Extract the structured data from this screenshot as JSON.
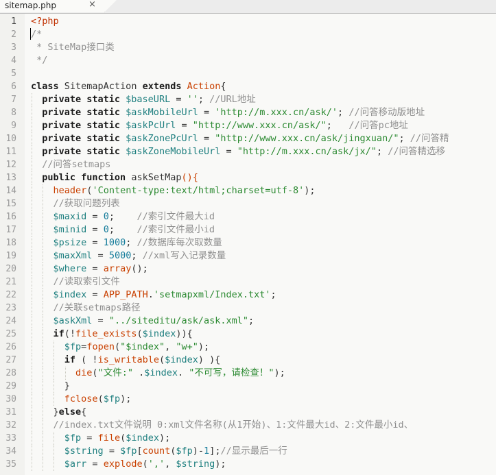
{
  "tab": {
    "filename": "sitemap.php",
    "close": "×"
  },
  "lines": [
    [
      {
        "t": "<?php",
        "c": "php"
      }
    ],
    [
      {
        "t": "/*",
        "c": "cm"
      }
    ],
    [
      {
        "t": " * SiteMap接口类",
        "c": "cm"
      }
    ],
    [
      {
        "t": " */",
        "c": "cm"
      }
    ],
    [],
    [
      {
        "t": "class ",
        "c": "kw"
      },
      {
        "t": "SitemapAction ",
        "c": ""
      },
      {
        "t": "extends ",
        "c": "kw"
      },
      {
        "t": "Action",
        "c": "fn"
      },
      {
        "t": "{",
        "c": ""
      }
    ],
    [
      {
        "t": "  private static ",
        "c": "kw"
      },
      {
        "t": "$baseURL",
        "c": "var"
      },
      {
        "t": " = ",
        "c": ""
      },
      {
        "t": "''",
        "c": "str"
      },
      {
        "t": "; ",
        "c": ""
      },
      {
        "t": "//URL地址",
        "c": "cm"
      }
    ],
    [
      {
        "t": "  private static ",
        "c": "kw"
      },
      {
        "t": "$askMobileUrl",
        "c": "var"
      },
      {
        "t": " = ",
        "c": ""
      },
      {
        "t": "'http://m.xxx.cn/ask/'",
        "c": "str"
      },
      {
        "t": "; ",
        "c": ""
      },
      {
        "t": "//问答移动版地址",
        "c": "cm"
      }
    ],
    [
      {
        "t": "  private static ",
        "c": "kw"
      },
      {
        "t": "$askPcUrl",
        "c": "var"
      },
      {
        "t": " = ",
        "c": ""
      },
      {
        "t": "\"http://www.xxx.cn/ask/\"",
        "c": "str"
      },
      {
        "t": ";   ",
        "c": ""
      },
      {
        "t": "//问答pc地址",
        "c": "cm"
      }
    ],
    [
      {
        "t": "  private static ",
        "c": "kw"
      },
      {
        "t": "$askZonePcUrl",
        "c": "var"
      },
      {
        "t": " = ",
        "c": ""
      },
      {
        "t": "\"http://www.xxx.cn/ask/jingxuan/\"",
        "c": "str"
      },
      {
        "t": "; ",
        "c": ""
      },
      {
        "t": "//问答精",
        "c": "cm"
      }
    ],
    [
      {
        "t": "  private static ",
        "c": "kw"
      },
      {
        "t": "$askZoneMobileUrl",
        "c": "var"
      },
      {
        "t": " = ",
        "c": ""
      },
      {
        "t": "\"http://m.xxx.cn/ask/jx/\"",
        "c": "str"
      },
      {
        "t": "; ",
        "c": ""
      },
      {
        "t": "//问答精选移",
        "c": "cm"
      }
    ],
    [
      {
        "t": "  //问答setmaps",
        "c": "cm"
      }
    ],
    [
      {
        "t": "  public function ",
        "c": "kw"
      },
      {
        "t": "askSetMap",
        "c": ""
      },
      {
        "t": "(){",
        "c": "fn"
      }
    ],
    [
      {
        "t": "    ",
        "c": ""
      },
      {
        "t": "header",
        "c": "fn"
      },
      {
        "t": "(",
        "c": ""
      },
      {
        "t": "'Content-type:text/html;charset=utf-8'",
        "c": "str"
      },
      {
        "t": ");",
        "c": ""
      }
    ],
    [
      {
        "t": "    //获取问题列表",
        "c": "cm"
      }
    ],
    [
      {
        "t": "    ",
        "c": ""
      },
      {
        "t": "$maxid",
        "c": "var"
      },
      {
        "t": " = ",
        "c": ""
      },
      {
        "t": "0",
        "c": "num"
      },
      {
        "t": ";    ",
        "c": ""
      },
      {
        "t": "//索引文件最大id",
        "c": "cm"
      }
    ],
    [
      {
        "t": "    ",
        "c": ""
      },
      {
        "t": "$minid",
        "c": "var"
      },
      {
        "t": " = ",
        "c": ""
      },
      {
        "t": "0",
        "c": "num"
      },
      {
        "t": ";    ",
        "c": ""
      },
      {
        "t": "//索引文件最小id",
        "c": "cm"
      }
    ],
    [
      {
        "t": "    ",
        "c": ""
      },
      {
        "t": "$psize",
        "c": "var"
      },
      {
        "t": " = ",
        "c": ""
      },
      {
        "t": "1000",
        "c": "num"
      },
      {
        "t": "; ",
        "c": ""
      },
      {
        "t": "//数据库每次取数量",
        "c": "cm"
      }
    ],
    [
      {
        "t": "    ",
        "c": ""
      },
      {
        "t": "$maxXml",
        "c": "var"
      },
      {
        "t": " = ",
        "c": ""
      },
      {
        "t": "5000",
        "c": "num"
      },
      {
        "t": "; ",
        "c": ""
      },
      {
        "t": "//xml写入记录数量",
        "c": "cm"
      }
    ],
    [
      {
        "t": "    ",
        "c": ""
      },
      {
        "t": "$where",
        "c": "var"
      },
      {
        "t": " = ",
        "c": ""
      },
      {
        "t": "array",
        "c": "fn"
      },
      {
        "t": "();",
        "c": ""
      }
    ],
    [
      {
        "t": "    //读取索引文件",
        "c": "cm"
      }
    ],
    [
      {
        "t": "    ",
        "c": ""
      },
      {
        "t": "$index",
        "c": "var"
      },
      {
        "t": " = ",
        "c": ""
      },
      {
        "t": "APP_PATH",
        "c": "fn"
      },
      {
        "t": ".",
        "c": ""
      },
      {
        "t": "'setmapxml/Index.txt'",
        "c": "str"
      },
      {
        "t": ";",
        "c": ""
      }
    ],
    [
      {
        "t": "    //关联setmaps路径",
        "c": "cm"
      }
    ],
    [
      {
        "t": "    ",
        "c": ""
      },
      {
        "t": "$askXml",
        "c": "var"
      },
      {
        "t": " = ",
        "c": ""
      },
      {
        "t": "\"../siteditu/ask/ask.xml\"",
        "c": "str"
      },
      {
        "t": ";",
        "c": ""
      }
    ],
    [
      {
        "t": "    ",
        "c": ""
      },
      {
        "t": "if",
        "c": "bld"
      },
      {
        "t": "(!",
        "c": ""
      },
      {
        "t": "file_exists",
        "c": "fn"
      },
      {
        "t": "(",
        "c": ""
      },
      {
        "t": "$index",
        "c": "var"
      },
      {
        "t": ")){",
        "c": ""
      }
    ],
    [
      {
        "t": "      ",
        "c": ""
      },
      {
        "t": "$fp",
        "c": "var"
      },
      {
        "t": "=",
        "c": ""
      },
      {
        "t": "fopen",
        "c": "fn"
      },
      {
        "t": "(",
        "c": ""
      },
      {
        "t": "\"$index\"",
        "c": "str"
      },
      {
        "t": ", ",
        "c": ""
      },
      {
        "t": "\"w+\"",
        "c": "str"
      },
      {
        "t": ");",
        "c": ""
      }
    ],
    [
      {
        "t": "      ",
        "c": ""
      },
      {
        "t": "if",
        "c": "bld"
      },
      {
        "t": " ( !",
        "c": ""
      },
      {
        "t": "is_writable",
        "c": "fn"
      },
      {
        "t": "(",
        "c": ""
      },
      {
        "t": "$index",
        "c": "var"
      },
      {
        "t": ") ){",
        "c": ""
      }
    ],
    [
      {
        "t": "        ",
        "c": ""
      },
      {
        "t": "die",
        "c": "fn"
      },
      {
        "t": "(",
        "c": ""
      },
      {
        "t": "\"文件:\"",
        "c": "str"
      },
      {
        "t": " .",
        "c": ""
      },
      {
        "t": "$index",
        "c": "var"
      },
      {
        "t": ". ",
        "c": ""
      },
      {
        "t": "\"不可写，请检查！\"",
        "c": "str"
      },
      {
        "t": ");",
        "c": ""
      }
    ],
    [
      {
        "t": "      }",
        "c": ""
      }
    ],
    [
      {
        "t": "      ",
        "c": ""
      },
      {
        "t": "fclose",
        "c": "fn"
      },
      {
        "t": "(",
        "c": ""
      },
      {
        "t": "$fp",
        "c": "var"
      },
      {
        "t": ");",
        "c": ""
      }
    ],
    [
      {
        "t": "    }",
        "c": ""
      },
      {
        "t": "else",
        "c": "bld"
      },
      {
        "t": "{",
        "c": ""
      }
    ],
    [
      {
        "t": "    //index.txt文件说明 0:xml文件名称(从1开始)、1:文件最大id、2:文件最小id、",
        "c": "cm"
      }
    ],
    [
      {
        "t": "      ",
        "c": ""
      },
      {
        "t": "$fp",
        "c": "var"
      },
      {
        "t": " = ",
        "c": ""
      },
      {
        "t": "file",
        "c": "fn"
      },
      {
        "t": "(",
        "c": ""
      },
      {
        "t": "$index",
        "c": "var"
      },
      {
        "t": ");",
        "c": ""
      }
    ],
    [
      {
        "t": "      ",
        "c": ""
      },
      {
        "t": "$string",
        "c": "var"
      },
      {
        "t": " = ",
        "c": ""
      },
      {
        "t": "$fp",
        "c": "var"
      },
      {
        "t": "[",
        "c": ""
      },
      {
        "t": "count",
        "c": "fn"
      },
      {
        "t": "(",
        "c": ""
      },
      {
        "t": "$fp",
        "c": "var"
      },
      {
        "t": ")-",
        "c": ""
      },
      {
        "t": "1",
        "c": "num"
      },
      {
        "t": "];",
        "c": ""
      },
      {
        "t": "//显示最后一行",
        "c": "cm"
      }
    ],
    [
      {
        "t": "      ",
        "c": ""
      },
      {
        "t": "$arr",
        "c": "var"
      },
      {
        "t": " = ",
        "c": ""
      },
      {
        "t": "explode",
        "c": "fn"
      },
      {
        "t": "(",
        "c": ""
      },
      {
        "t": "','",
        "c": "str"
      },
      {
        "t": ", ",
        "c": ""
      },
      {
        "t": "$string",
        "c": "var"
      },
      {
        "t": ");",
        "c": ""
      }
    ]
  ]
}
